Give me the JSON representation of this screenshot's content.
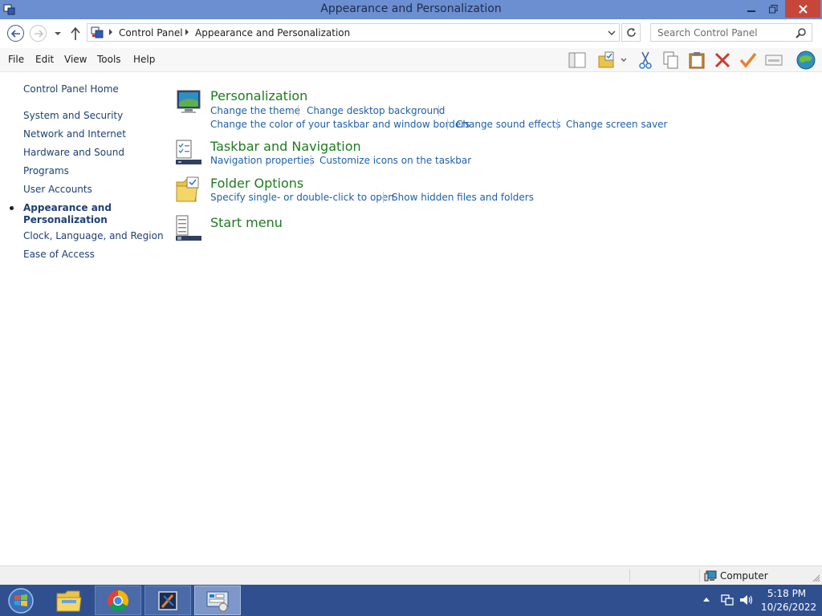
{
  "window": {
    "title": "Appearance and Personalization"
  },
  "address_bar": {
    "crumbs": [
      "Control Panel",
      "Appearance and Personalization"
    ]
  },
  "search": {
    "placeholder": "Search Control Panel"
  },
  "menu": {
    "items": [
      "File",
      "Edit",
      "View",
      "Tools",
      "Help"
    ]
  },
  "toolbar": {
    "icons": [
      "layout-icon",
      "folder-options-icon",
      "cut-icon",
      "copy-icon",
      "paste-icon",
      "delete-icon",
      "checkmark-icon",
      "properties-icon",
      "globe-icon"
    ]
  },
  "left_nav": {
    "home": "Control Panel Home",
    "items": [
      "System and Security",
      "Network and Internet",
      "Hardware and Sound",
      "Programs",
      "User Accounts",
      "Appearance and",
      "Personalization",
      "Clock, Language, and Region",
      "Ease of Access"
    ]
  },
  "categories": [
    {
      "title": "Personalization",
      "links": [
        "Change the theme",
        "Change desktop background",
        "Change the color of your taskbar and window borders",
        "Change sound effects",
        "Change screen saver"
      ]
    },
    {
      "title": "Taskbar and Navigation",
      "links": [
        "Navigation properties",
        "Customize icons on the taskbar"
      ]
    },
    {
      "title": "Folder Options",
      "links": [
        "Specify single- or double-click to open",
        "Show hidden files and folders"
      ]
    },
    {
      "title": "Start menu",
      "links": []
    }
  ],
  "status_bar": {
    "location": "Computer"
  },
  "taskbar": {
    "apps": [
      "start-button",
      "file-explorer",
      "chrome",
      "app-3",
      "control-panel"
    ]
  },
  "clock": {
    "time": "5:18 PM",
    "date": "10/26/2022"
  },
  "colors": {
    "link": "#1e5fa8",
    "category_title": "#1e7b1e",
    "title_bar": "#6b8fd0",
    "taskbar": "#2f4f8f"
  }
}
